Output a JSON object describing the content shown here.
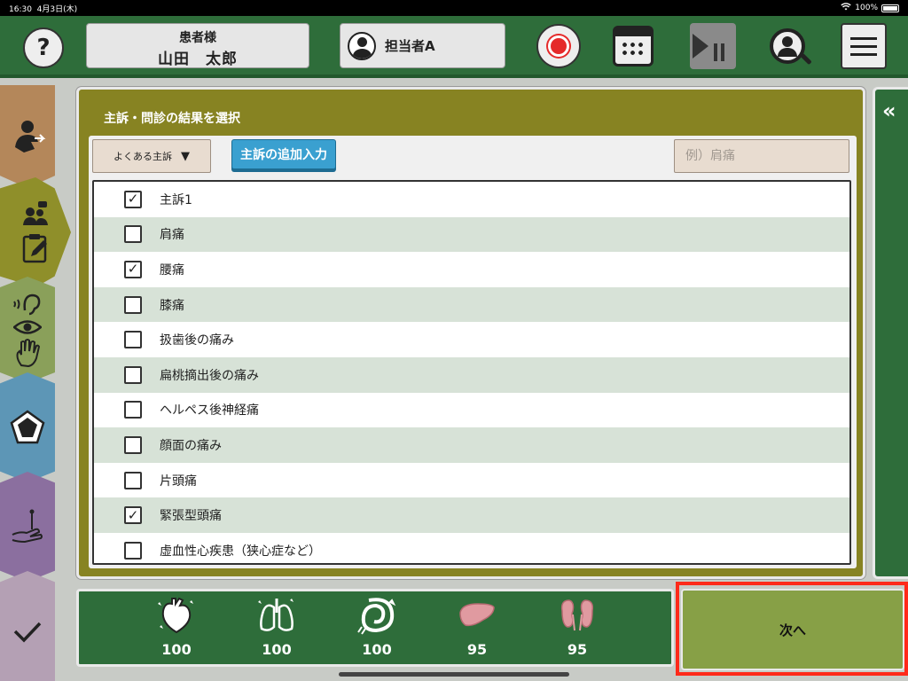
{
  "status_bar": {
    "time": "16:30",
    "date": "4月3日(木)",
    "battery": "100%"
  },
  "header": {
    "help_label": "?",
    "patient_label": "患者様",
    "patient_name": "山田　太郎",
    "staff_name": "担当者A"
  },
  "main": {
    "title": "主訴・問診の結果を選択",
    "dropdown_label": "よくある主訴",
    "dropdown_arrow": "▼",
    "add_button": "主訴の追加入力",
    "example_placeholder": "例）肩痛",
    "items": [
      {
        "label": "主訴1",
        "checked": true
      },
      {
        "label": "肩痛",
        "checked": false
      },
      {
        "label": "腰痛",
        "checked": true
      },
      {
        "label": "膝痛",
        "checked": false
      },
      {
        "label": "扱歯後の痛み",
        "checked": false
      },
      {
        "label": "扁桃摘出後の痛み",
        "checked": false
      },
      {
        "label": "ヘルペス後神経痛",
        "checked": false
      },
      {
        "label": "顔面の痛み",
        "checked": false
      },
      {
        "label": "片頭痛",
        "checked": false
      },
      {
        "label": "緊張型頭痛",
        "checked": true
      },
      {
        "label": "虚血性心疾患（狭心症など）",
        "checked": false
      }
    ]
  },
  "right_panel": {
    "collapse_glyph": "«"
  },
  "vitals": [
    {
      "organ": "heart",
      "value": "100"
    },
    {
      "organ": "lungs",
      "value": "100"
    },
    {
      "organ": "intestine",
      "value": "100"
    },
    {
      "organ": "liver",
      "value": "95"
    },
    {
      "organ": "kidneys",
      "value": "95"
    }
  ],
  "footer": {
    "next_label": "次へ"
  },
  "colors": {
    "header_green": "#2e6d3a",
    "panel_olive": "#878322",
    "next_green": "#87a046",
    "highlight_red": "#ff2a1a",
    "add_button_blue": "#3aa0d0"
  }
}
